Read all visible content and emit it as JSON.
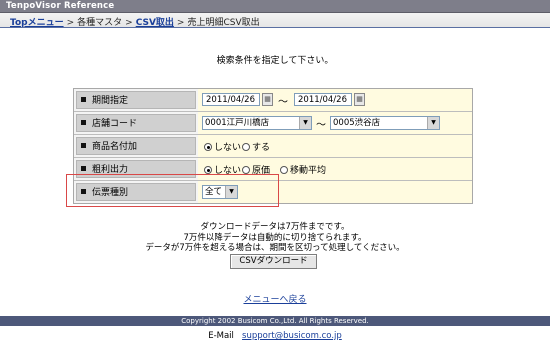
{
  "app": {
    "title": "TenpoVisor Reference"
  },
  "breadcrumb": {
    "top": "Topメニュー",
    "sep": ">",
    "master": "各種マスタ",
    "csv": "CSV取出",
    "current": "売上明細CSV取出"
  },
  "instruction": "検索条件を指定して下さい。",
  "form": {
    "period": {
      "label": "期間指定",
      "from": "2011/04/26",
      "to": "2011/04/26",
      "tilde": "～"
    },
    "store": {
      "label": "店舗コード",
      "from": "0001江戸川橋店",
      "to": "0005渋谷店",
      "tilde": "～"
    },
    "product_name": {
      "label": "商品名付加",
      "options": [
        "しない",
        "する"
      ],
      "selected": "しない"
    },
    "gross_profit": {
      "label": "粗利出力",
      "options": [
        "しない",
        "原価",
        "移動平均"
      ],
      "selected": "しない"
    },
    "slip_type": {
      "label": "伝票種別",
      "selected": "全て"
    }
  },
  "notes": {
    "line1": "ダウンロードデータは7万件までです。",
    "line2": "7万件以降データは自動的に切り捨てられます。",
    "line3": "データが7万件を超える場合は、期間を区切って処理してください。"
  },
  "download_button": "CSVダウンロード",
  "back_link": "メニューへ戻る",
  "footer": {
    "copyright": "Copyright 2002 Busicom Co.,Ltd. All Rights Reserved.",
    "email_label": "E-Mail",
    "email": "support@busicom.co.jp"
  },
  "colors": {
    "title_bar": "#7e7e8a",
    "label_cell": "#d0d0d0",
    "value_cell": "#fffbe0",
    "footer": "#4d587a",
    "link": "#1a3f9a",
    "highlight": "#d94848"
  }
}
